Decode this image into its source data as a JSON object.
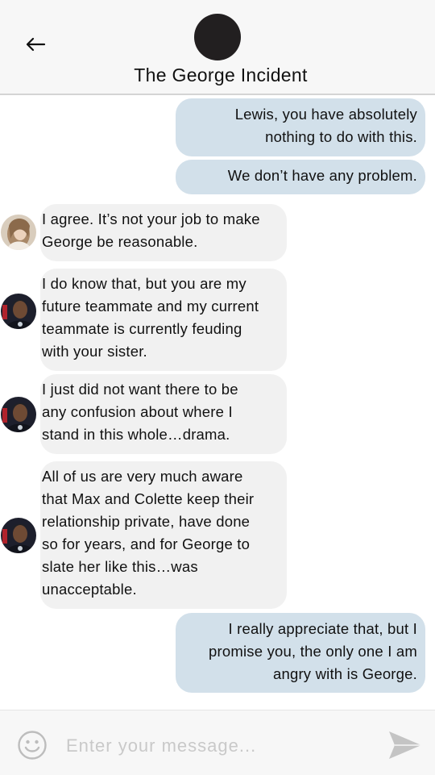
{
  "header": {
    "title": "The George Incident",
    "back_icon": "arrow-left-icon",
    "group_avatar_color": "#221f20"
  },
  "messages": [
    {
      "direction": "outgoing",
      "lines": [
        "Lewis, you have absolutely",
        "nothing to do with this."
      ]
    },
    {
      "direction": "outgoing",
      "lines": [
        "We don’t have any problem."
      ]
    },
    {
      "direction": "incoming",
      "sender_avatar": "woman-avatar",
      "lines": [
        "I agree. It’s not your job to make",
        "George be reasonable."
      ]
    },
    {
      "direction": "incoming",
      "sender_avatar": "lewis-avatar",
      "lines": [
        "I do know that, but you are my",
        "future teammate and my current",
        "teammate is currently feuding",
        "with your sister."
      ]
    },
    {
      "direction": "incoming",
      "sender_avatar": "lewis-avatar",
      "lines": [
        "I just did not want there to be",
        "any confusion about where I",
        "stand in this whole…drama."
      ]
    },
    {
      "direction": "incoming",
      "sender_avatar": "lewis-avatar",
      "lines": [
        "All of us are very much aware",
        "that Max and Colette keep their",
        "relationship private, have done",
        "so for years, and for George to",
        "slate her like this…was",
        "unacceptable."
      ]
    },
    {
      "direction": "outgoing",
      "lines": [
        "I really appreciate that, but I",
        "promise you, the only one I am",
        "angry with is George."
      ]
    }
  ],
  "composer": {
    "placeholder": "Enter your message...",
    "value": "",
    "emoji_icon": "smiley-icon",
    "send_icon": "send-arrow-icon"
  },
  "colors": {
    "outgoing_bubble": "#d2e0ea",
    "incoming_bubble": "#f1f1f1",
    "header_bg": "#f7f7f7"
  }
}
